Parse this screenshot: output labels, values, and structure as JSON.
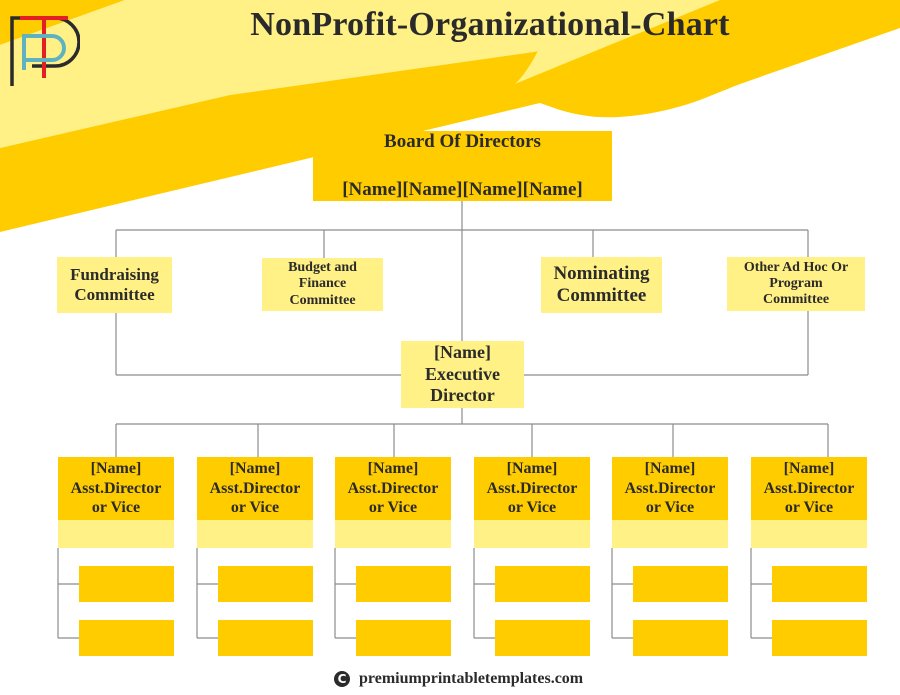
{
  "title": "NonProfit-Organizational-Chart",
  "logo": {
    "icon": "ptp-logo-icon",
    "colors": {
      "black": "#2b2b2b",
      "red": "#e31e24",
      "teal": "#5fb3c1"
    }
  },
  "colors": {
    "dark_yellow": "#ffcc00",
    "light_yellow": "#fff185",
    "line": "#8c8c8c",
    "text": "#2b2b2b"
  },
  "board": {
    "title": "Board Of Directors",
    "names": "[Name][Name][Name][Name]"
  },
  "committees": [
    {
      "label": "Fundraising\nCommittee"
    },
    {
      "label": "Budget and\nFinance\nCommittee"
    },
    {
      "label": "Nominating\nCommittee"
    },
    {
      "label": "Other Ad Hoc Or\nProgram\nCommittee"
    }
  ],
  "executive": {
    "label": "[Name]\nExecutive\nDirector"
  },
  "assistants": [
    {
      "label": "[Name]\nAsst.Director\nor Vice",
      "subordinates": [
        "",
        ""
      ]
    },
    {
      "label": "[Name]\nAsst.Director\nor Vice",
      "subordinates": [
        "",
        ""
      ]
    },
    {
      "label": "[Name]\nAsst.Director\nor Vice",
      "subordinates": [
        "",
        ""
      ]
    },
    {
      "label": "[Name]\nAsst.Director\nor Vice",
      "subordinates": [
        "",
        ""
      ]
    },
    {
      "label": "[Name]\nAsst.Director\nor Vice",
      "subordinates": [
        "",
        ""
      ]
    },
    {
      "label": "[Name]\nAsst.Director\nor Vice",
      "subordinates": [
        "",
        ""
      ]
    }
  ],
  "footer": {
    "icon": "copyright-icon",
    "symbol": "C",
    "text": "premiumprintabletemplates.com"
  }
}
